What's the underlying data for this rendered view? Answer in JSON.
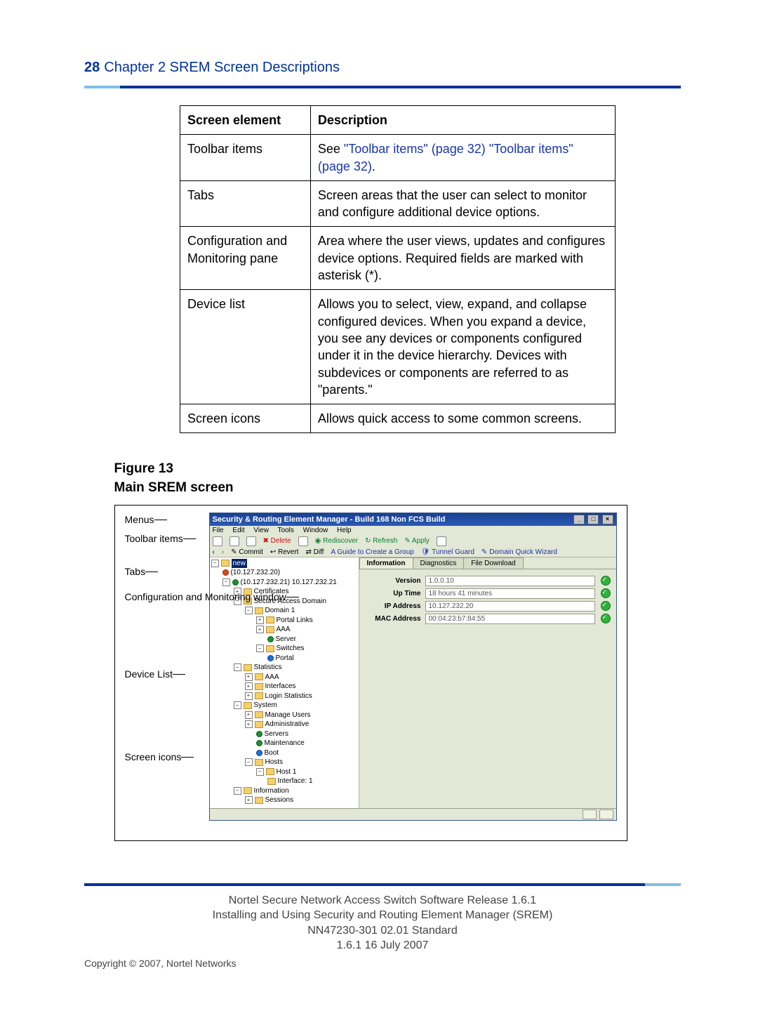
{
  "header": {
    "page": "28",
    "chapter": "Chapter 2  SREM Screen Descriptions"
  },
  "table": {
    "cols": [
      "Screen element",
      "Description"
    ],
    "rows": [
      {
        "el": "Toolbar items",
        "desc_pre": "See ",
        "link1": "\"Toolbar items\" (page 32)",
        "mid": " ",
        "link2": "\"Toolbar items\" (page 32)",
        "post": "."
      },
      {
        "el": "Tabs",
        "desc": "Screen areas that the user can select to monitor and configure additional device options."
      },
      {
        "el": "Configuration and Monitoring pane",
        "desc": "Area where the user views, updates and configures device options.  Required fields are marked with asterisk (*)."
      },
      {
        "el": "Device list",
        "desc": "Allows you to select, view, expand, and collapse configured devices.  When you expand a device, you see any devices or components configured under it in the device hierarchy.  Devices with subdevices or components are referred to as \"parents.\""
      },
      {
        "el": "Screen icons",
        "desc": "Allows quick access to some common screens."
      }
    ]
  },
  "figure": {
    "num": "Figure 13",
    "title": "Main SREM screen"
  },
  "callouts": {
    "menus": "Menus",
    "toolbar": "Toolbar items",
    "tabs": "Tabs",
    "config": "Configuration and Monitoring window",
    "device": "Device List",
    "icons": "Screen icons"
  },
  "app": {
    "title": "Security & Routing Element Manager - Build 168 Non FCS Build",
    "menu": [
      "File",
      "Edit",
      "View",
      "Tools",
      "Window",
      "Help"
    ],
    "tb1": {
      "delete": "Delete",
      "rediscover": "Rediscover",
      "refresh": "Refresh",
      "apply": "Apply"
    },
    "tb2": {
      "commit": "Commit",
      "revert": "Revert",
      "diff": "Diff",
      "guide": "A Guide to Create a Group",
      "tunnel": "Tunnel Guard",
      "wizard": "Domain Quick Wizard"
    },
    "tree": {
      "root": "new",
      "ip1": "(10.127.232.20)",
      "ip2": "(10.127.232.21) 10.127.232.21",
      "cert": "Certificates",
      "sad": "Secure Access Domain",
      "dom1": "Domain 1",
      "portal_links": "Portal Links",
      "aaa": "AAA",
      "server": "Server",
      "switches": "Switches",
      "portal": "Portal",
      "stats": "Statistics",
      "aaa2": "AAA",
      "intf": "Interfaces",
      "login": "Login Statistics",
      "system": "System",
      "musers": "Manage Users",
      "admin": "Administrative",
      "servers": "Servers",
      "maint": "Maintenance",
      "boot": "Boot",
      "hosts": "Hosts",
      "host1": "Host 1",
      "intf1": "Interface: 1",
      "info": "Information",
      "sessions": "Sessions"
    },
    "tabs": [
      "Information",
      "Diagnostics",
      "File Download"
    ],
    "info": [
      {
        "k": "Version",
        "v": "1.0.0.10"
      },
      {
        "k": "Up Time",
        "v": "18 hours 41 minutes"
      },
      {
        "k": "IP Address",
        "v": "10.127.232.20"
      },
      {
        "k": "MAC Address",
        "v": "00:04:23:b7:84:55"
      }
    ]
  },
  "footer": {
    "l1": "Nortel Secure Network Access Switch Software Release 1.6.1",
    "l2": "Installing and Using Security and Routing Element Manager (SREM)",
    "l3": "NN47230-301   02.01   Standard",
    "l4": "1.6.1   16 July 2007",
    "copy": "Copyright © 2007, Nortel Networks"
  }
}
